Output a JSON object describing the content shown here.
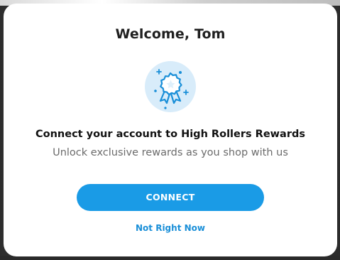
{
  "modal": {
    "title": "Welcome, Tom",
    "icon": "award-ribbon-icon",
    "headline": "Connect your account to High Rollers Rewards",
    "subtext": "Unlock exclusive rewards as you shop with us",
    "primary_button_label": "CONNECT",
    "secondary_link_label": "Not Right Now"
  },
  "colors": {
    "accent": "#1a9be6",
    "badge_background": "#d8ecfa",
    "link": "#1a8fd8"
  }
}
